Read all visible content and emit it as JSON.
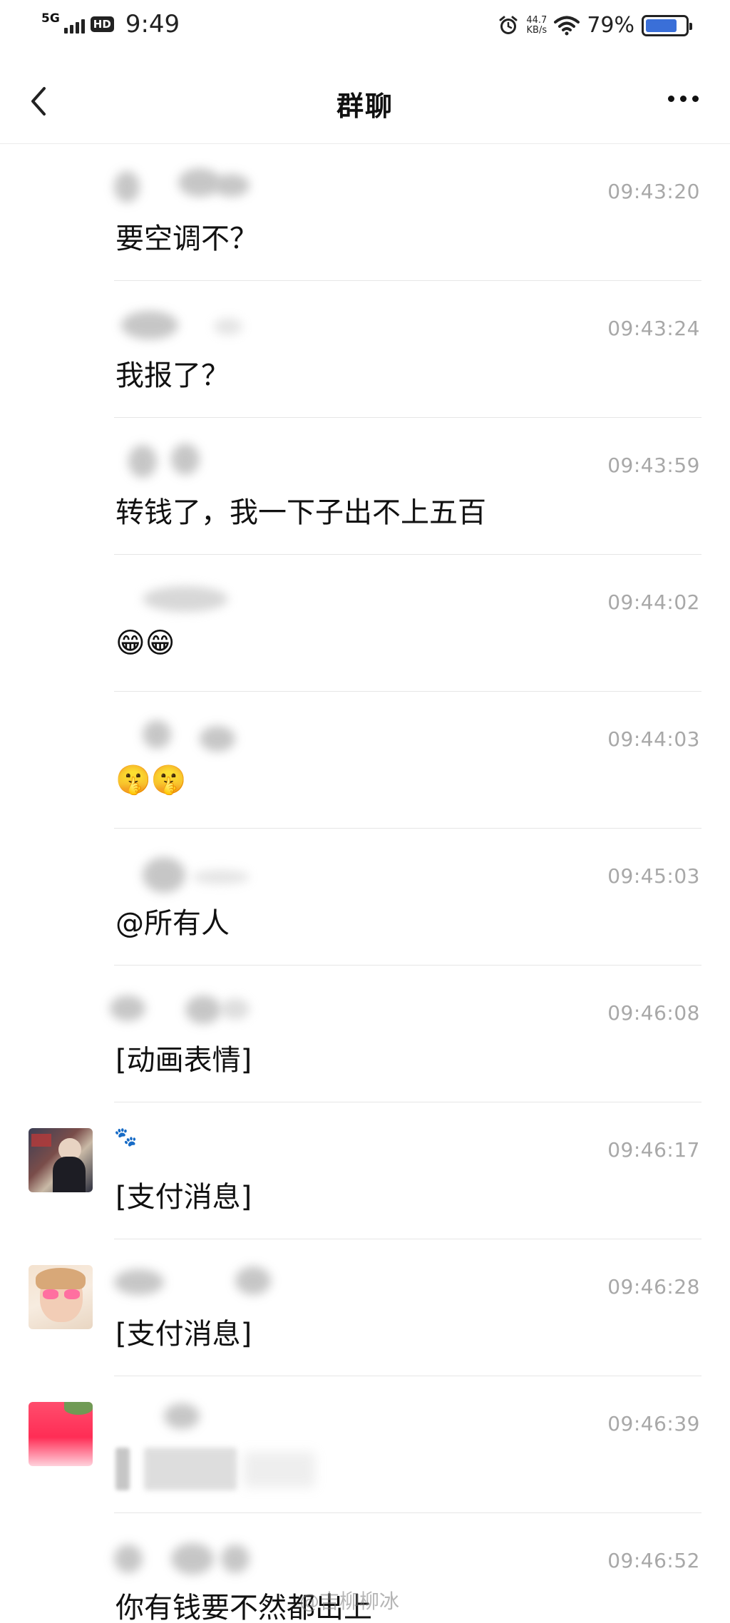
{
  "status_bar": {
    "network": "5G",
    "hd_label": "HD",
    "time": "9:49",
    "net_speed_value": "44.7",
    "net_speed_unit": "KB/s",
    "battery_percent": "79%",
    "battery_level": 0.79,
    "icons": [
      "signal-icon",
      "alarm-icon",
      "wifi-icon",
      "battery-icon"
    ]
  },
  "nav": {
    "back_icon": "chevron-left-icon",
    "title": "群聊",
    "more_icon": "more-icon"
  },
  "messages": [
    {
      "time": "09:43:20",
      "content": "要空调不？",
      "avatar": "none"
    },
    {
      "time": "09:43:24",
      "content": "我报了？",
      "avatar": "none"
    },
    {
      "time": "09:43:59",
      "content": "转钱了，我一下子出不上五百",
      "avatar": "none"
    },
    {
      "time": "09:44:02",
      "content": "😁😁",
      "avatar": "none"
    },
    {
      "time": "09:44:03",
      "content": "🤫🤫",
      "avatar": "none"
    },
    {
      "time": "09:45:03",
      "content": "@所有人",
      "avatar": "none"
    },
    {
      "time": "09:46:08",
      "content": "[动画表情]",
      "avatar": "none"
    },
    {
      "time": "09:46:17",
      "content": "[支付消息]",
      "sender": "🐾",
      "avatar": "photo-dark"
    },
    {
      "time": "09:46:28",
      "content": "[支付消息]",
      "avatar": "photo-pink"
    },
    {
      "time": "09:46:39",
      "content": "",
      "avatar": "photo-red"
    },
    {
      "time": "09:46:52",
      "content": "你有钱要不然都出上",
      "avatar": "none"
    }
  ],
  "watermark": "@吉柳柳冰"
}
